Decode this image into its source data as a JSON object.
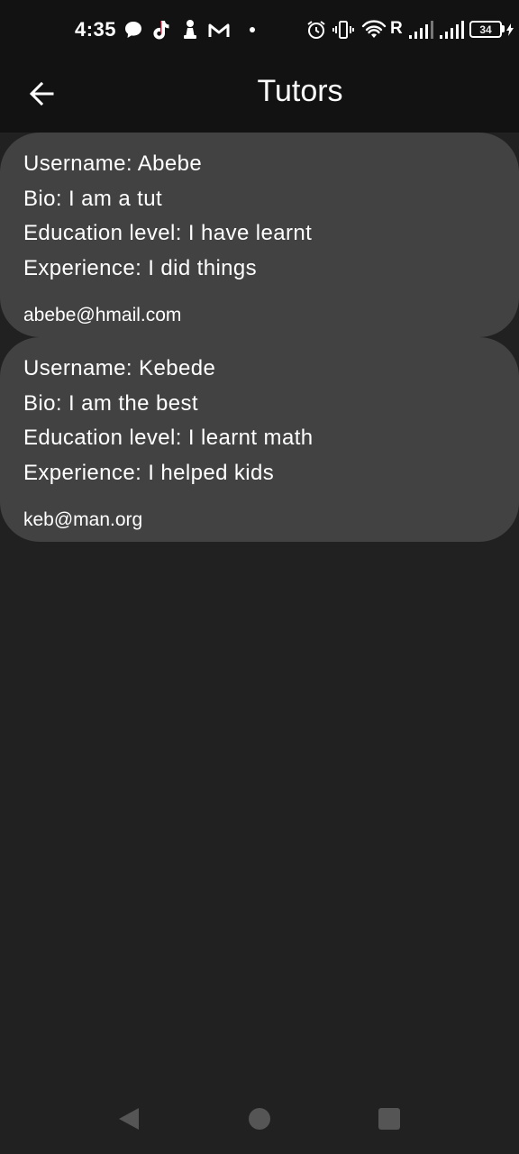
{
  "status_bar": {
    "time": "4:35",
    "network_label": "R",
    "battery": "34",
    "icons": [
      "chat-bubble-icon",
      "tiktok-icon",
      "chess-pawn-icon",
      "gmail-icon",
      "dot-icon",
      "alarm-icon",
      "vibrate-icon",
      "wifi-icon",
      "signal-icon",
      "signal-icon",
      "battery-icon",
      "charging-icon"
    ]
  },
  "app_bar": {
    "title": "Tutors",
    "back_icon": "arrow-left-icon"
  },
  "tutors": [
    {
      "username": "Username: Abebe",
      "bio": "Bio: I am a tut",
      "education": "Education level: I have learnt",
      "experience": "Experience: I did things",
      "email": "abebe@hmail.com"
    },
    {
      "username": "Username: Kebede",
      "bio": "Bio: I am the best",
      "education": "Education level: I learnt math",
      "experience": "Experience: I helped kids",
      "email": "keb@man.org"
    }
  ],
  "nav_bar": {
    "icons": [
      "back-triangle-icon",
      "home-circle-icon",
      "recents-square-icon"
    ]
  },
  "colors": {
    "background": "#212121",
    "app_bar": "#121212",
    "card": "#424242",
    "text": "#ffffff"
  }
}
